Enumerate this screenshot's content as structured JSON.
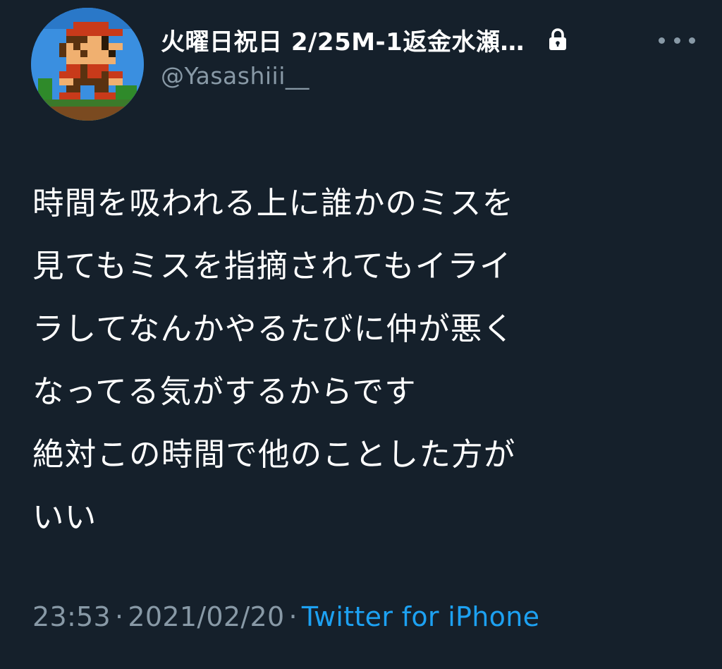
{
  "user": {
    "display_name": "火曜日祝日 2/25M-1返金水瀬…",
    "handle": "@Yasashiii__",
    "avatar_icon": "pixel-mario-avatar",
    "protected_icon": "lock-icon"
  },
  "tweet": {
    "text": "時間を吸われる上に誰かのミスを\n見てもミスを指摘されてもイライ\nラしてなんかやるたびに仲が悪く\nなってる気がするからです\n絶対この時間で他のことした方が\nいい",
    "time": "23:53",
    "separator": "·",
    "date": "2021/02/20",
    "source": "Twitter for iPhone"
  },
  "colors": {
    "background": "#15202b",
    "primary_text": "#ffffff",
    "secondary_text": "#8899a6",
    "link": "#1da1f2"
  },
  "icons": {
    "more": "more-options-icon"
  }
}
